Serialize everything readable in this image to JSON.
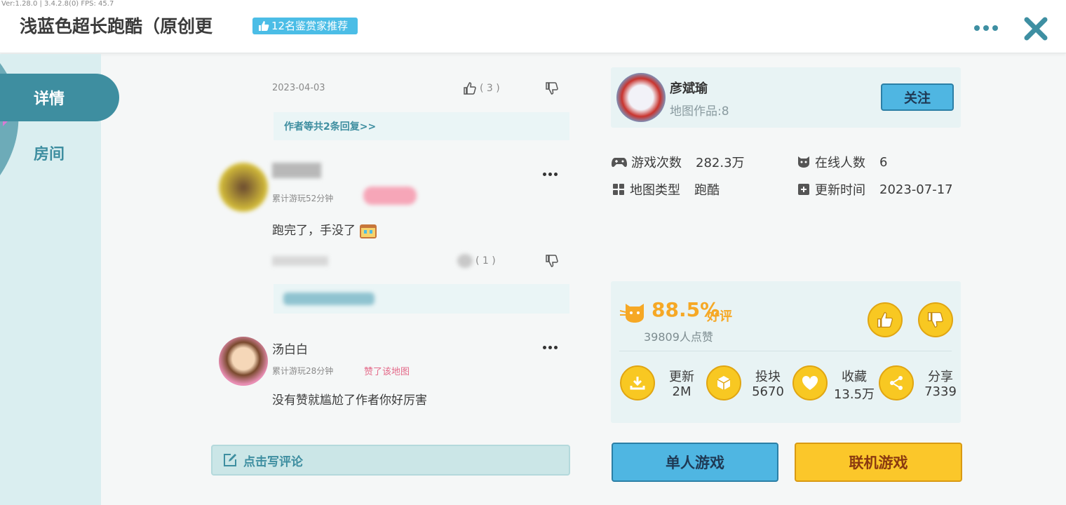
{
  "debug_text": "Ver:1.28.0 | 3.4.2.8(0) FPS: 45.7",
  "header": {
    "title": "浅蓝色超长跑酷（原创更",
    "badge": "12名鉴赏家推荐"
  },
  "sidebar": {
    "tabs": [
      {
        "label": "详情",
        "active": true
      },
      {
        "label": "房间",
        "active": false
      }
    ]
  },
  "comments": {
    "first": {
      "date": "2023-04-03",
      "likes": "( 3 )",
      "reply_link": "作者等共2条回复>>"
    },
    "second": {
      "name": "",
      "play_time": "累计游玩52分钟",
      "text": "跑完了，手没了",
      "likes": "( 1 )"
    },
    "third": {
      "name": "汤白白",
      "play_time": "累计游玩28分钟",
      "liked_tag": "赞了该地图",
      "text": "没有赞就尴尬了作者你好厉害"
    },
    "write_label": "点击写评论"
  },
  "author": {
    "name": "彦斌瑜",
    "works": "地图作品:8",
    "follow_label": "关注"
  },
  "stats": {
    "plays_label": "游戏次数",
    "plays_value": "282.3万",
    "online_label": "在线人数",
    "online_value": "6",
    "type_label": "地图类型",
    "type_value": "跑酷",
    "update_label": "更新时间",
    "update_value": "2023-07-17"
  },
  "rating": {
    "percent": "88.5%",
    "good_label": "好评",
    "likes_people": "39809人点赞"
  },
  "actions": [
    {
      "label": "更新",
      "value": "2M"
    },
    {
      "label": "投块",
      "value": "5670"
    },
    {
      "label": "收藏",
      "value": "13.5万"
    },
    {
      "label": "分享",
      "value": "7339"
    }
  ],
  "buttons": {
    "single": "单人游戏",
    "multi": "联机游戏"
  },
  "colors": {
    "accent": "#3e8ea0",
    "yellow": "#f8c822",
    "blue": "#4fb6e2"
  }
}
